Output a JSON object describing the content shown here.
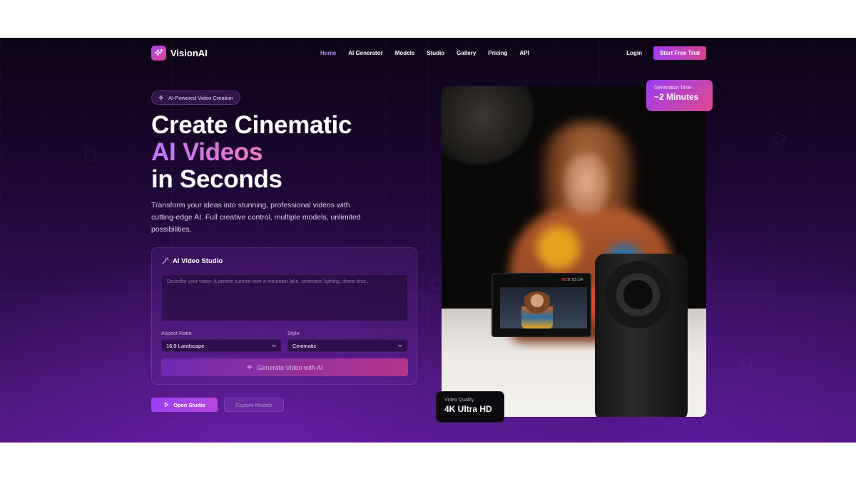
{
  "nav": {
    "brand": "VisionAI",
    "links": [
      "Home",
      "AI Generator",
      "Models",
      "Studio",
      "Gallery",
      "Pricing",
      "API"
    ],
    "active_link": "Home",
    "login": "Login",
    "trial": "Start Free Trial"
  },
  "hero": {
    "badge": "AI-Powered Video Creation",
    "headline_line1": "Create Cinematic",
    "headline_line2": "AI Videos",
    "headline_line3": "in Seconds",
    "subtext": "Transform your ideas into stunning, professional videos with cutting-edge AI. Full creative control, multiple models, unlimited possibilities."
  },
  "studio": {
    "title": "AI Video Studio",
    "prompt_placeholder": "Describe your video: A serene sunrise over a mountain lake, cinematic lighting, drone shot...",
    "aspect_label": "Aspect Ratio",
    "aspect_value": "16:9 Landscape",
    "style_label": "Style",
    "style_value": "Cinematic",
    "generate": "Generate Video with AI"
  },
  "cta": {
    "primary": "Open Studio",
    "secondary": "Explore Models"
  },
  "cards": {
    "gen_label": "Generation Time",
    "gen_value": "~2 Minutes",
    "quality_label": "Video Quality",
    "quality_value": "4K Ultra HD"
  },
  "camera_screen": {
    "timecode": "0:03:24",
    "rec": "REC"
  },
  "colors": {
    "accent_purple": "#9d3fef",
    "accent_pink": "#de4a8f",
    "active_link": "#c08af7"
  },
  "icons": {
    "logo": "sparkles-icon",
    "badge": "sparkles-icon",
    "studio": "magic-wand-icon",
    "generate": "sparkles-icon",
    "play": "play-icon",
    "dropdown": "chevron-down-icon"
  }
}
